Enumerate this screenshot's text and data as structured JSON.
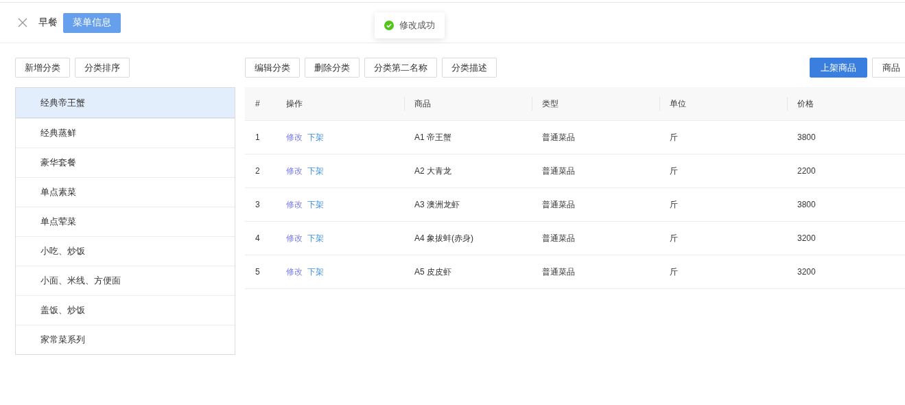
{
  "header": {
    "title": "早餐",
    "tabs": [
      {
        "label": "菜单信息",
        "selected": true
      }
    ]
  },
  "toast": {
    "kind": "success",
    "message": "修改成功"
  },
  "category_actions": [
    "新增分类",
    "分类排序"
  ],
  "categories": [
    {
      "label": "经典帝王蟹",
      "selected": true
    },
    {
      "label": "经典蒸鲜",
      "selected": false
    },
    {
      "label": "豪华套餐",
      "selected": false
    },
    {
      "label": "单点素菜",
      "selected": false
    },
    {
      "label": "单点荤菜",
      "selected": false
    },
    {
      "label": "小吃、炒饭",
      "selected": false
    },
    {
      "label": "小面、米线、方便面",
      "selected": false
    },
    {
      "label": "盖饭、炒饭",
      "selected": false
    },
    {
      "label": "家常菜系列",
      "selected": false
    }
  ],
  "toolbar": {
    "left": [
      "编辑分类",
      "删除分类",
      "分类第二名称",
      "分类描述"
    ],
    "right": [
      {
        "label": "上架商品",
        "kind": "primary"
      },
      {
        "label": "商品",
        "kind": "default"
      }
    ]
  },
  "table": {
    "columns": [
      "#",
      "操作",
      "商品",
      "类型",
      "单位",
      "价格"
    ],
    "rows": [
      {
        "index": "1",
        "actions": [
          {
            "label": "修改",
            "kind": "edit"
          },
          {
            "label": "下架",
            "kind": "offline"
          }
        ],
        "product": "A1 帝王蟹",
        "type": "普通菜品",
        "unit": "斤",
        "price": "3800"
      },
      {
        "index": "2",
        "actions": [
          {
            "label": "修改",
            "kind": "edit"
          },
          {
            "label": "下架",
            "kind": "offline"
          }
        ],
        "product": "A2 大青龙",
        "type": "普通菜品",
        "unit": "斤",
        "price": "2200"
      },
      {
        "index": "3",
        "actions": [
          {
            "label": "修改",
            "kind": "edit"
          },
          {
            "label": "下架",
            "kind": "offline"
          }
        ],
        "product": "A3 澳洲龙虾",
        "type": "普通菜品",
        "unit": "斤",
        "price": "3800"
      },
      {
        "index": "4",
        "actions": [
          {
            "label": "修改",
            "kind": "edit"
          },
          {
            "label": "下架",
            "kind": "offline"
          }
        ],
        "product": "A4 象拔蚌(赤身)",
        "type": "普通菜品",
        "unit": "斤",
        "price": "3200"
      },
      {
        "index": "5",
        "actions": [
          {
            "label": "修改",
            "kind": "edit"
          },
          {
            "label": "下架",
            "kind": "offline"
          }
        ],
        "product": "A5 皮皮虾",
        "type": "普通菜品",
        "unit": "斤",
        "price": "3200"
      }
    ]
  }
}
